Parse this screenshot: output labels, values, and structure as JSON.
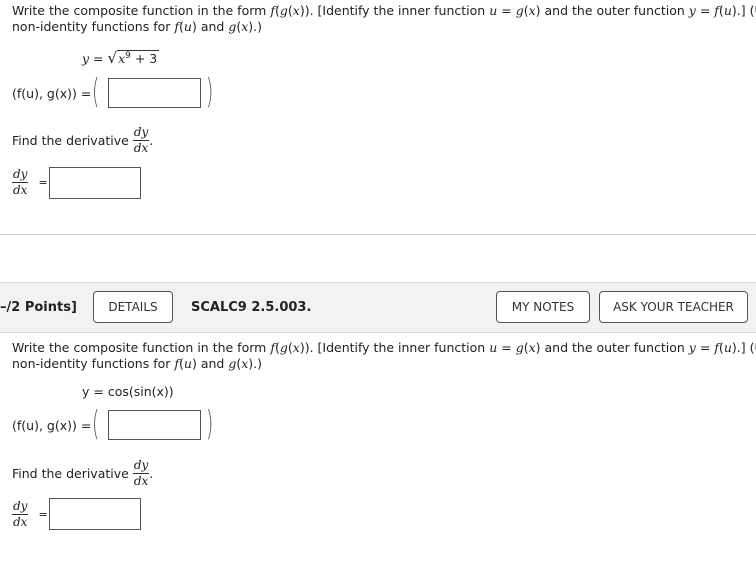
{
  "question1": {
    "prompt_line1_parts": [
      "Write the composite function in the form ",
      "f",
      "(",
      "g",
      "(",
      "x",
      ")). [Identify the inner function ",
      "u",
      " = ",
      "g",
      "(",
      "x",
      ") and the outer function ",
      "y",
      " = ",
      "f",
      "(",
      "u",
      ").] (Use"
    ],
    "prompt_line2_parts": [
      "non-identity functions for ",
      "f",
      "(",
      "u",
      ") and ",
      "g",
      "(",
      "x",
      ").)"
    ],
    "equation": {
      "lhs": "y",
      "eq": "=",
      "radicand_base": "x",
      "radicand_exp": "9",
      "radicand_rest": " + 3"
    },
    "pair_label": "(f(u), g(x)) =",
    "composite_answer": "",
    "derivative_prompt": "Find the derivative",
    "dy": "dy",
    "dx": "dx",
    "period": ".",
    "eq": "=",
    "derivative_answer": ""
  },
  "question2": {
    "points_label": "–/2 Points]",
    "details_button": "DETAILS",
    "question_id": "SCALC9 2.5.003.",
    "my_notes_button": "MY NOTES",
    "ask_teacher_button": "ASK YOUR TEACHER",
    "prompt_line1_parts": [
      "Write the composite function in the form ",
      "f",
      "(",
      "g",
      "(",
      "x",
      ")). [Identify the inner function ",
      "u",
      " = ",
      "g",
      "(",
      "x",
      ") and the outer function ",
      "y",
      " = ",
      "f",
      "(",
      "u",
      ").] (Use"
    ],
    "prompt_line2_parts": [
      "non-identity functions for ",
      "f",
      "(",
      "u",
      ") and ",
      "g",
      "(",
      "x",
      ").)"
    ],
    "equation": "y = cos(sin(x))",
    "pair_label": "(f(u), g(x)) =",
    "composite_answer": "",
    "derivative_prompt": "Find the derivative",
    "dy": "dy",
    "dx": "dx",
    "period": ".",
    "eq": "=",
    "derivative_answer": ""
  }
}
